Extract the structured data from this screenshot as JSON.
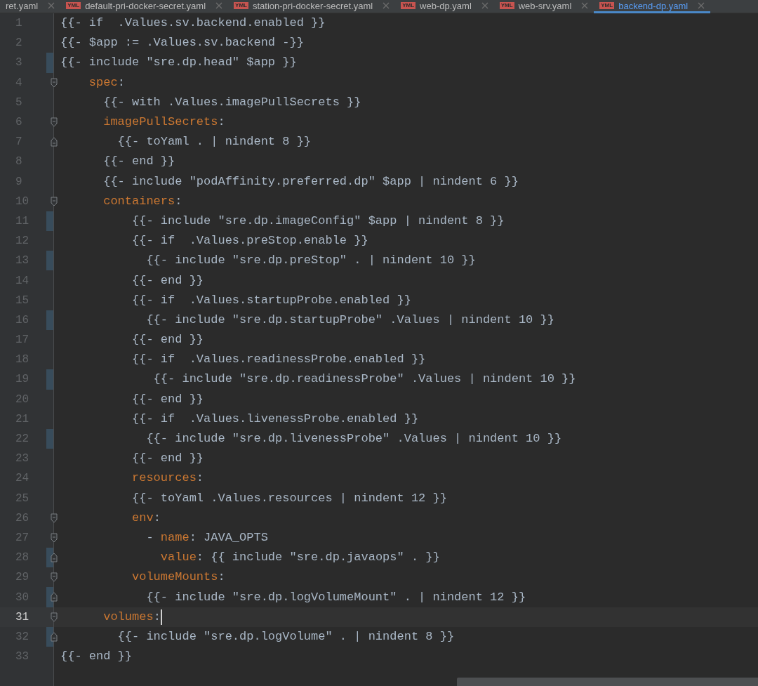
{
  "tabs": [
    {
      "label": "ret.yaml",
      "selected": false
    },
    {
      "label": "default-pri-docker-secret.yaml",
      "badge": "YML",
      "selected": false
    },
    {
      "label": "station-pri-docker-secret.yaml",
      "badge": "YML",
      "selected": false
    },
    {
      "label": "web-dp.yaml",
      "badge": "YML",
      "selected": false
    },
    {
      "label": "web-srv.yaml",
      "badge": "YML",
      "selected": false
    },
    {
      "label": "backend-dp.yaml",
      "badge": "YML",
      "selected": true
    }
  ],
  "lines": [
    {
      "number": "1",
      "changed": false,
      "fold_open": false,
      "fold_close": false,
      "current": false,
      "tokens": [
        {
          "kind": "text",
          "text": "{{- if  .Values.sv.backend.enabled }}"
        }
      ]
    },
    {
      "number": "2",
      "changed": false,
      "fold_open": false,
      "fold_close": false,
      "current": false,
      "tokens": [
        {
          "kind": "text",
          "text": "{{- $app := .Values.sv.backend -}}"
        }
      ]
    },
    {
      "number": "3",
      "changed": true,
      "fold_open": false,
      "fold_close": false,
      "current": false,
      "tokens": [
        {
          "kind": "text",
          "text": "{{- include \"sre.dp.head\" $app }}"
        }
      ]
    },
    {
      "number": "4",
      "changed": false,
      "fold_open": true,
      "fold_close": false,
      "current": false,
      "tokens": [
        {
          "kind": "key",
          "text": "    spec"
        },
        {
          "kind": "text",
          "text": ":"
        }
      ]
    },
    {
      "number": "5",
      "changed": false,
      "fold_open": false,
      "fold_close": false,
      "current": false,
      "tokens": [
        {
          "kind": "text",
          "text": "      {{- with .Values.imagePullSecrets }}"
        }
      ]
    },
    {
      "number": "6",
      "changed": false,
      "fold_open": true,
      "fold_close": false,
      "current": false,
      "tokens": [
        {
          "kind": "key",
          "text": "      imagePullSecrets"
        },
        {
          "kind": "text",
          "text": ":"
        }
      ]
    },
    {
      "number": "7",
      "changed": false,
      "fold_open": false,
      "fold_close": true,
      "current": false,
      "tokens": [
        {
          "kind": "text",
          "text": "        {{- toYaml . | nindent 8 }}"
        }
      ]
    },
    {
      "number": "8",
      "changed": false,
      "fold_open": false,
      "fold_close": false,
      "current": false,
      "tokens": [
        {
          "kind": "text",
          "text": "      {{- end }}"
        }
      ]
    },
    {
      "number": "9",
      "changed": false,
      "fold_open": false,
      "fold_close": false,
      "current": false,
      "tokens": [
        {
          "kind": "text",
          "text": "      {{- include \"podAffinity.preferred.dp\" $app | nindent 6 }}"
        }
      ]
    },
    {
      "number": "10",
      "changed": false,
      "fold_open": true,
      "fold_close": false,
      "current": false,
      "tokens": [
        {
          "kind": "key",
          "text": "      containers"
        },
        {
          "kind": "text",
          "text": ":"
        }
      ]
    },
    {
      "number": "11",
      "changed": true,
      "fold_open": false,
      "fold_close": false,
      "current": false,
      "tokens": [
        {
          "kind": "text",
          "text": "          {{- include \"sre.dp.imageConfig\" $app | nindent 8 }}"
        }
      ]
    },
    {
      "number": "12",
      "changed": false,
      "fold_open": false,
      "fold_close": false,
      "current": false,
      "tokens": [
        {
          "kind": "text",
          "text": "          {{- if  .Values.preStop.enable }}"
        }
      ]
    },
    {
      "number": "13",
      "changed": true,
      "fold_open": false,
      "fold_close": false,
      "current": false,
      "tokens": [
        {
          "kind": "text",
          "text": "            {{- include \"sre.dp.preStop\" . | nindent 10 }}"
        }
      ]
    },
    {
      "number": "14",
      "changed": false,
      "fold_open": false,
      "fold_close": false,
      "current": false,
      "tokens": [
        {
          "kind": "text",
          "text": "          {{- end }}"
        }
      ]
    },
    {
      "number": "15",
      "changed": false,
      "fold_open": false,
      "fold_close": false,
      "current": false,
      "tokens": [
        {
          "kind": "text",
          "text": "          {{- if  .Values.startupProbe.enabled }}"
        }
      ]
    },
    {
      "number": "16",
      "changed": true,
      "fold_open": false,
      "fold_close": false,
      "current": false,
      "tokens": [
        {
          "kind": "text",
          "text": "            {{- include \"sre.dp.startupProbe\" .Values | nindent 10 }}"
        }
      ]
    },
    {
      "number": "17",
      "changed": false,
      "fold_open": false,
      "fold_close": false,
      "current": false,
      "tokens": [
        {
          "kind": "text",
          "text": "          {{- end }}"
        }
      ]
    },
    {
      "number": "18",
      "changed": false,
      "fold_open": false,
      "fold_close": false,
      "current": false,
      "tokens": [
        {
          "kind": "text",
          "text": "          {{- if  .Values.readinessProbe.enabled }}"
        }
      ]
    },
    {
      "number": "19",
      "changed": true,
      "fold_open": false,
      "fold_close": false,
      "current": false,
      "tokens": [
        {
          "kind": "text",
          "text": "             {{- include \"sre.dp.readinessProbe\" .Values | nindent 10 }}"
        }
      ]
    },
    {
      "number": "20",
      "changed": false,
      "fold_open": false,
      "fold_close": false,
      "current": false,
      "tokens": [
        {
          "kind": "text",
          "text": "          {{- end }}"
        }
      ]
    },
    {
      "number": "21",
      "changed": false,
      "fold_open": false,
      "fold_close": false,
      "current": false,
      "tokens": [
        {
          "kind": "text",
          "text": "          {{- if  .Values.livenessProbe.enabled }}"
        }
      ]
    },
    {
      "number": "22",
      "changed": true,
      "fold_open": false,
      "fold_close": false,
      "current": false,
      "tokens": [
        {
          "kind": "text",
          "text": "            {{- include \"sre.dp.livenessProbe\" .Values | nindent 10 }}"
        }
      ]
    },
    {
      "number": "23",
      "changed": false,
      "fold_open": false,
      "fold_close": false,
      "current": false,
      "tokens": [
        {
          "kind": "text",
          "text": "          {{- end }}"
        }
      ]
    },
    {
      "number": "24",
      "changed": false,
      "fold_open": false,
      "fold_close": false,
      "current": false,
      "tokens": [
        {
          "kind": "key",
          "text": "          resources"
        },
        {
          "kind": "text",
          "text": ":"
        }
      ]
    },
    {
      "number": "25",
      "changed": false,
      "fold_open": false,
      "fold_close": false,
      "current": false,
      "tokens": [
        {
          "kind": "text",
          "text": "          {{- toYaml .Values.resources | nindent 12 }}"
        }
      ]
    },
    {
      "number": "26",
      "changed": false,
      "fold_open": true,
      "fold_close": false,
      "current": false,
      "tokens": [
        {
          "kind": "key",
          "text": "          env"
        },
        {
          "kind": "text",
          "text": ":"
        }
      ]
    },
    {
      "number": "27",
      "changed": false,
      "fold_open": true,
      "fold_close": false,
      "current": false,
      "tokens": [
        {
          "kind": "text",
          "text": "            - "
        },
        {
          "kind": "key",
          "text": "name"
        },
        {
          "kind": "text",
          "text": ": JAVA_OPTS"
        }
      ]
    },
    {
      "number": "28",
      "changed": true,
      "fold_open": false,
      "fold_close": true,
      "current": false,
      "tokens": [
        {
          "kind": "key",
          "text": "              value"
        },
        {
          "kind": "text",
          "text": ": {{ include \"sre.dp.javaops\" . }}"
        }
      ]
    },
    {
      "number": "29",
      "changed": false,
      "fold_open": true,
      "fold_close": false,
      "current": false,
      "tokens": [
        {
          "kind": "key",
          "text": "          volumeMounts"
        },
        {
          "kind": "text",
          "text": ":"
        }
      ]
    },
    {
      "number": "30",
      "changed": true,
      "fold_open": false,
      "fold_close": true,
      "current": false,
      "tokens": [
        {
          "kind": "text",
          "text": "            {{- include \"sre.dp.logVolumeMount\" . | nindent 12 }}"
        }
      ]
    },
    {
      "number": "31",
      "changed": false,
      "fold_open": true,
      "fold_close": false,
      "current": true,
      "tokens": [
        {
          "kind": "key",
          "text": "      volumes"
        },
        {
          "kind": "text",
          "text": ":"
        }
      ]
    },
    {
      "number": "32",
      "changed": true,
      "fold_open": false,
      "fold_close": true,
      "current": false,
      "tokens": [
        {
          "kind": "text",
          "text": "        {{- include \"sre.dp.logVolume\" . | nindent 8 }}"
        }
      ]
    },
    {
      "number": "33",
      "changed": false,
      "fold_open": false,
      "fold_close": false,
      "current": false,
      "tokens": [
        {
          "kind": "text",
          "text": "{{- end }}"
        }
      ]
    }
  ]
}
